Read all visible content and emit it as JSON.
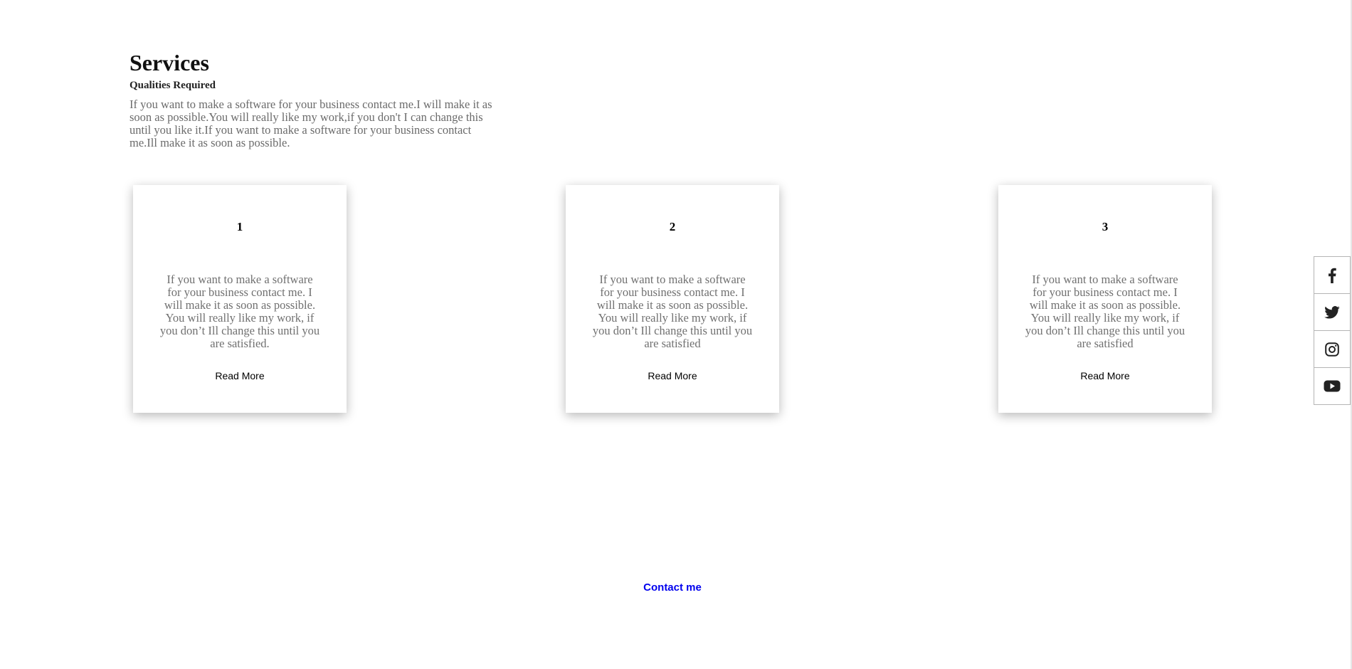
{
  "services": {
    "title": "Services",
    "subtitle": "Qualities Required",
    "intro": "If you want to make a software for your business contact me.I will make it as soon as possible.You will really like my work,if you don't I can change this until you like it.If you want to make a software for your business contact me.Ill make it as soon as possible."
  },
  "cards": [
    {
      "number": "1",
      "text": "If you want to make a software for your business contact me. I will make it as soon as possible. You will really like my work, if you don’t Ill change this until you are satisfied.",
      "link_label": "Read More"
    },
    {
      "number": "2",
      "text": "If you want to make a software for your business contact me. I will make it as soon as possible. You will really like my work, if you don’t Ill change this until you are satisfied",
      "link_label": "Read More"
    },
    {
      "number": "3",
      "text": "If you want to make a software for your business contact me. I will make it as soon as possible. You will really like my work, if you don’t Ill change this until you are satisfied",
      "link_label": "Read More"
    }
  ],
  "contact": {
    "label": "Contact me"
  },
  "social": {
    "icons": [
      "facebook-icon",
      "twitter-icon",
      "instagram-icon",
      "youtube-icon"
    ]
  },
  "colors": {
    "link": "#0000ee",
    "body_text": "#6b6b6b"
  }
}
